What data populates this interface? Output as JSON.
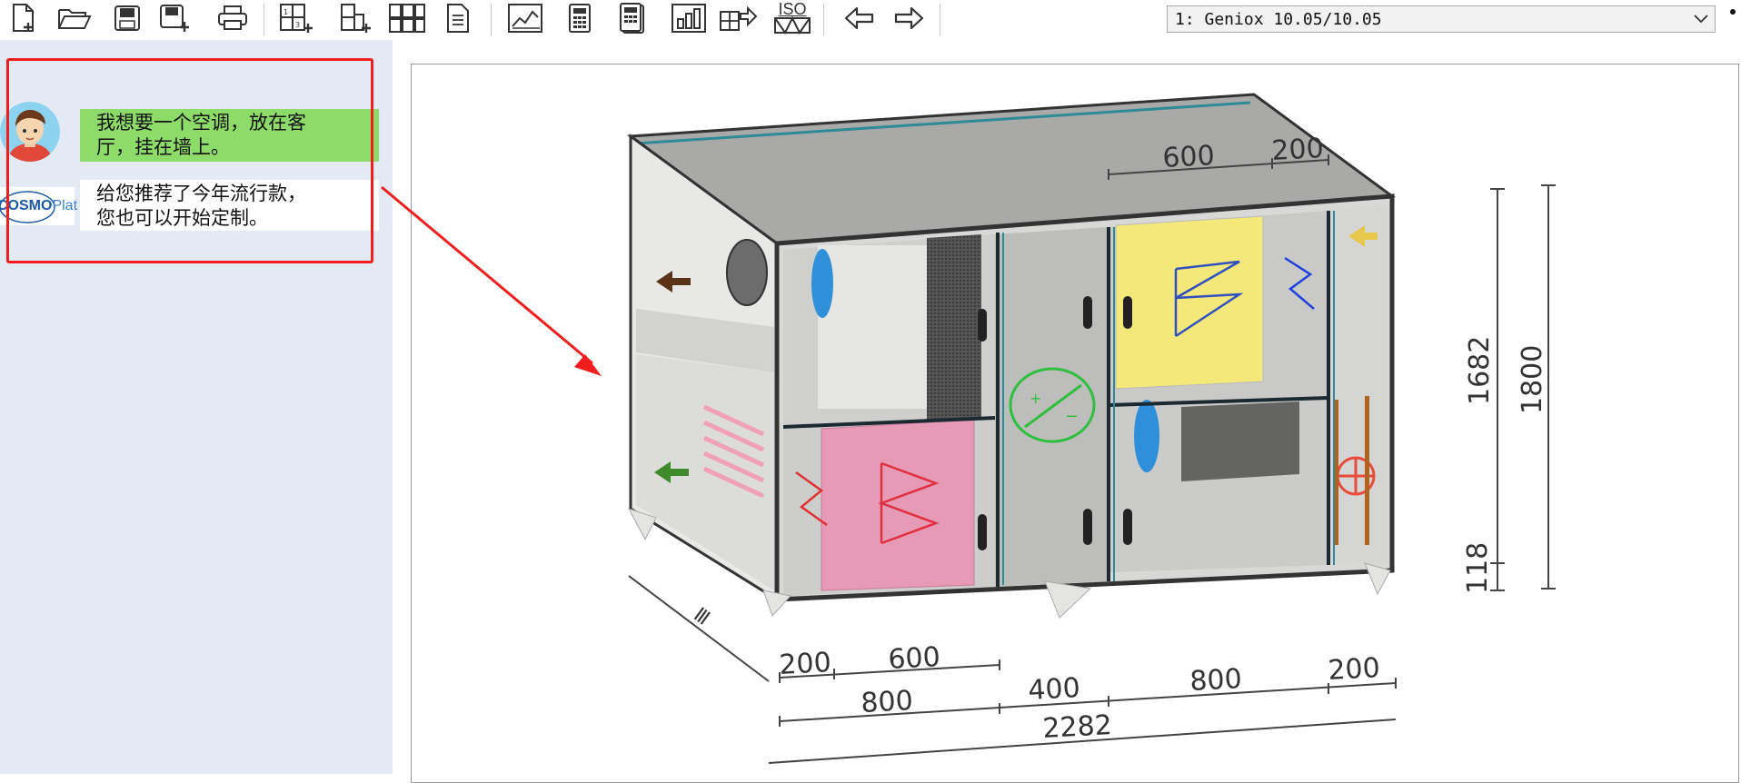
{
  "toolbar": {
    "buttons": [
      {
        "name": "new-document-icon"
      },
      {
        "name": "open-folder-icon"
      },
      {
        "name": "save-icon"
      },
      {
        "name": "save-as-icon"
      },
      {
        "name": "print-icon"
      },
      {
        "name": "unit-layout-icon"
      },
      {
        "name": "unit-add-icon"
      },
      {
        "name": "component-grid-icon"
      },
      {
        "name": "report-icon"
      },
      {
        "name": "chart-icon"
      },
      {
        "name": "calculator-icon"
      },
      {
        "name": "calculator-sheet-icon"
      },
      {
        "name": "performance-chart-icon"
      },
      {
        "name": "export-icon"
      },
      {
        "name": "iso-drawing-icon"
      },
      {
        "name": "arrow-left-icon"
      },
      {
        "name": "arrow-right-icon"
      }
    ],
    "iso_label": "ISO",
    "unit_select": "1: Geniox 10.05/10.05"
  },
  "chat": {
    "user_message_line1": "我想要一个空调，放在客",
    "user_message_line2": "厅，挂在墙上。",
    "bot_message_line1": "给您推荐了今年流行款，",
    "bot_message_line2": "您也可以开始定制。",
    "bot_logo_text_main": "COSMO",
    "bot_logo_text_thin": "Plat"
  },
  "drawing": {
    "dims": {
      "top_600": "600",
      "top_200": "200",
      "height_1682": "1682",
      "height_1800": "1800",
      "height_118": "118",
      "depth_label": "Ⅲ",
      "b_200_left": "200",
      "b_600": "600",
      "b_800_left": "800",
      "b_400": "400",
      "b_800_right": "800",
      "b_200_right": "200",
      "total_2282": "2282"
    }
  },
  "colors": {
    "annotation_red": "#f21d1d",
    "user_bubble": "#8ddc6a",
    "sidebar_bg": "#e4eaf3"
  }
}
